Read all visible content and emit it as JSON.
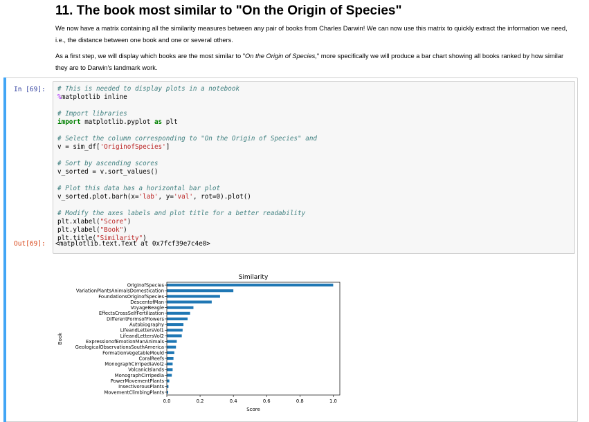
{
  "heading": "11. The book most similar to \"On the Origin of Species\"",
  "para1": "We now have a matrix containing all the similarity measures between any pair of books from Charles Darwin! We can now use this matrix to quickly extract the information we need, i.e., the distance between one book and one or several others.",
  "para2": {
    "before": "As a first step, we will display which books are the most similar to \"",
    "italic": "On the Origin of Species,",
    "after": "\" more specifically we will produce a bar chart showing all books ranked by how similar they are to Darwin's landmark work."
  },
  "cell": {
    "in_prompt": "In [69]:",
    "out_prompt": "Out[69]:",
    "output_text": "<matplotlib.text.Text at 0x7fcf39e7c4e0>",
    "code_lines": [
      [
        [
          "cm",
          "# This is needed to display plots in a notebook"
        ]
      ],
      [
        [
          "mg",
          "%"
        ],
        [
          "",
          "matplotlib inline"
        ]
      ],
      [
        [
          "",
          ""
        ]
      ],
      [
        [
          "cm",
          "# Import libraries"
        ]
      ],
      [
        [
          "kw",
          "import"
        ],
        [
          "",
          " matplotlib.pyplot "
        ],
        [
          "kw",
          "as"
        ],
        [
          "",
          " plt"
        ]
      ],
      [
        [
          "",
          ""
        ]
      ],
      [
        [
          "cm",
          "# Select the column corresponding to \"On the Origin of Species\" and"
        ]
      ],
      [
        [
          "",
          "v = sim_df["
        ],
        [
          "st",
          "'OriginofSpecies'"
        ],
        [
          "",
          "]"
        ]
      ],
      [
        [
          "",
          ""
        ]
      ],
      [
        [
          "cm",
          "# Sort by ascending scores"
        ]
      ],
      [
        [
          "",
          "v_sorted = v.sort_values()"
        ]
      ],
      [
        [
          "",
          ""
        ]
      ],
      [
        [
          "cm",
          "# Plot this data has a horizontal bar plot"
        ]
      ],
      [
        [
          "",
          "v_sorted.plot.barh(x="
        ],
        [
          "st",
          "'lab'"
        ],
        [
          "",
          ", y="
        ],
        [
          "st",
          "'val'"
        ],
        [
          "",
          ", rot=0).plot()"
        ]
      ],
      [
        [
          "",
          ""
        ]
      ],
      [
        [
          "cm",
          "# Modify the axes labels and plot title for a better readability"
        ]
      ],
      [
        [
          "",
          "plt.xlabel("
        ],
        [
          "st",
          "\"Score\""
        ],
        [
          "",
          ")"
        ]
      ],
      [
        [
          "",
          "plt.ylabel("
        ],
        [
          "st",
          "\"Book\""
        ],
        [
          "",
          ")"
        ]
      ],
      [
        [
          "",
          "plt.title("
        ],
        [
          "st",
          "\"Similarity\""
        ],
        [
          "",
          ")"
        ]
      ]
    ]
  },
  "colors": {
    "bar": "#1f77b4",
    "prompt_in": "#303f9f",
    "prompt_out": "#d84315",
    "cell_bar": "#42a5f5"
  },
  "chart_data": {
    "type": "bar",
    "orientation": "horizontal",
    "title": "Similarity",
    "xlabel": "Score",
    "ylabel": "Book",
    "xlim": [
      0,
      1.04
    ],
    "xticks": [
      "0.0",
      "0.2",
      "0.4",
      "0.6",
      "0.8",
      "1.0"
    ],
    "categories": [
      "OriginofSpecies",
      "VariationPlantsAnimalsDomestication",
      "FoundationsOriginofSpecies",
      "DescentofMan",
      "VoyageBeagle",
      "EffectsCrossSelfFertilization",
      "DifferentFormsofFlowers",
      "Autobiography",
      "LifeandLettersVol1",
      "LifeandLettersVol2",
      "ExpressionofEmotionManAnimals",
      "GeologicalObservationsSouthAmerica",
      "FormationVegetableMould",
      "CoralReefs",
      "MonographCirripediaVol2",
      "VolcanicIslands",
      "MonographCirripedia",
      "PowerMovementPlants",
      "InsectivorousPlants",
      "MovementClimbingPlants"
    ],
    "values": [
      1.0,
      0.4,
      0.32,
      0.27,
      0.16,
      0.14,
      0.125,
      0.1,
      0.095,
      0.09,
      0.06,
      0.055,
      0.045,
      0.04,
      0.035,
      0.035,
      0.03,
      0.015,
      0.01,
      0.008
    ]
  }
}
